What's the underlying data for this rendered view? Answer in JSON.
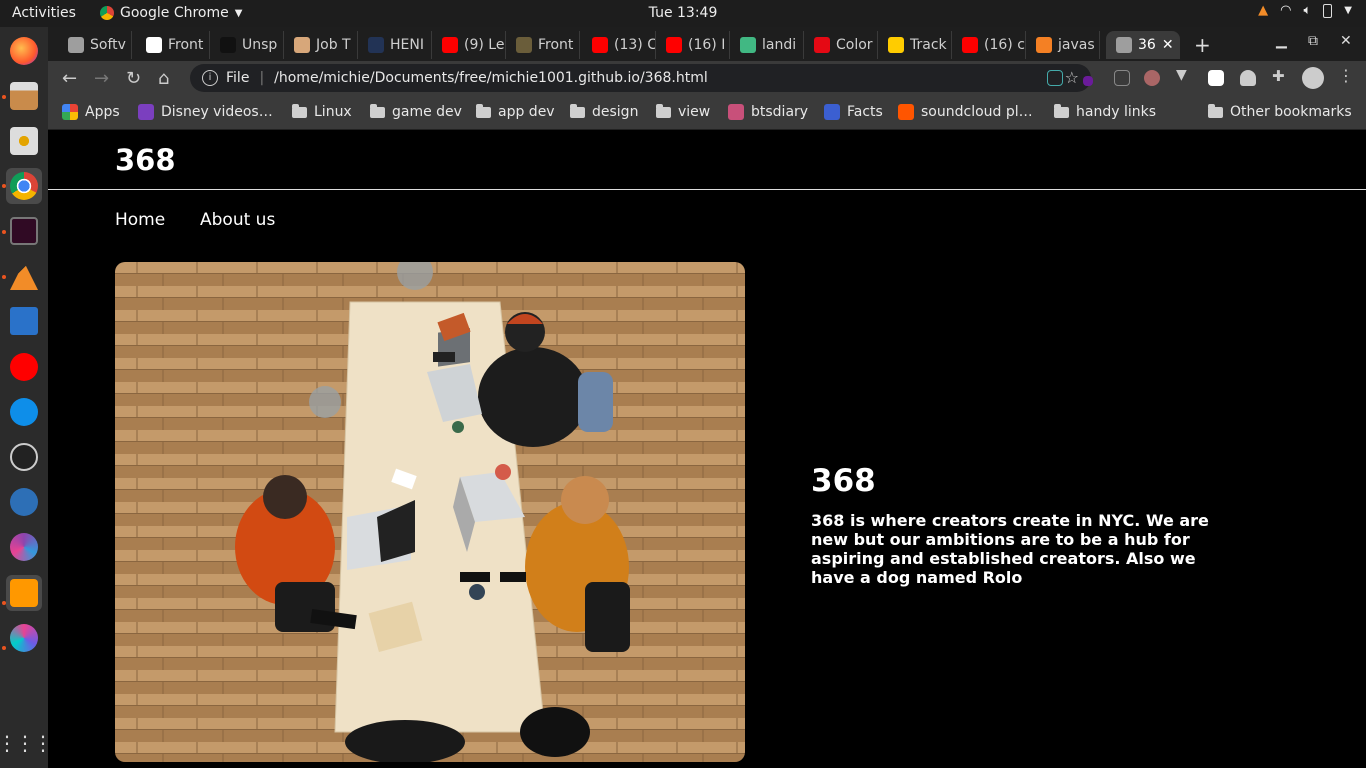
{
  "system": {
    "activities": "Activities",
    "app_name": "Google Chrome",
    "clock": "Tue 13:49"
  },
  "browser": {
    "tabs": [
      {
        "label": "Softv",
        "color": "#9e9e9e"
      },
      {
        "label": "Front",
        "color": "#ffffff"
      },
      {
        "label": "Unsp",
        "color": "#111111"
      },
      {
        "label": "Job T",
        "color": "#d7a77a"
      },
      {
        "label": "HENI",
        "color": "#223355"
      },
      {
        "label": "(9) Le",
        "color": "#ff0000"
      },
      {
        "label": "Front",
        "color": "#6a5d3a"
      },
      {
        "label": "(13) C",
        "color": "#ff0000"
      },
      {
        "label": "(16) I",
        "color": "#ff0000"
      },
      {
        "label": "landi",
        "color": "#41b883"
      },
      {
        "label": "Color",
        "color": "#e50914"
      },
      {
        "label": "Track",
        "color": "#ffcc00"
      },
      {
        "label": "(16) c",
        "color": "#ff0000"
      },
      {
        "label": "javas",
        "color": "#f48024"
      },
      {
        "label": "36",
        "color": "#9e9e9e"
      }
    ],
    "address": {
      "scheme": "File",
      "url": "/home/michie/Documents/free/michie1001.github.io/368.html"
    },
    "bookmarks": [
      {
        "label": "Apps",
        "kind": "apps-icon"
      },
      {
        "label": "Disney videos…",
        "kind": "disney-icon"
      },
      {
        "label": "Linux",
        "kind": "folder-icon"
      },
      {
        "label": "game dev",
        "kind": "folder-icon"
      },
      {
        "label": "app dev",
        "kind": "folder-icon"
      },
      {
        "label": "design",
        "kind": "folder-icon"
      },
      {
        "label": "view",
        "kind": "folder-icon"
      },
      {
        "label": "btsdiary",
        "kind": "btsdiary-icon"
      },
      {
        "label": "Facts",
        "kind": "facts-icon"
      },
      {
        "label": "soundcloud pl…",
        "kind": "soundcloud-icon"
      },
      {
        "label": "handy links",
        "kind": "folder-icon"
      },
      {
        "label": "Other bookmarks",
        "kind": "folder-icon"
      }
    ]
  },
  "site": {
    "title": "368",
    "nav": [
      "Home",
      "About us"
    ],
    "hero": {
      "heading": "368",
      "text": "368 is where creators create in NYC. We are new but our ambitions are to be a hub for aspiring and established creators. Also we have a dog named Rolo"
    }
  }
}
